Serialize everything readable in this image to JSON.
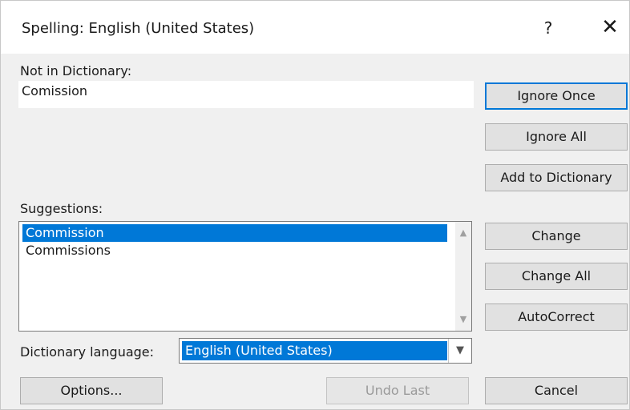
{
  "window": {
    "title": "Spelling: English (United States)",
    "help": "?",
    "close": "✕"
  },
  "not_in_dictionary": {
    "label": "Not in Dictionary:",
    "value": "Comission"
  },
  "buttons": {
    "ignore_once": "Ignore Once",
    "ignore_all": "Ignore All",
    "add_to_dictionary": "Add to Dictionary",
    "change": "Change",
    "change_all": "Change All",
    "autocorrect": "AutoCorrect",
    "options": "Options...",
    "undo_last": "Undo Last",
    "cancel": "Cancel"
  },
  "suggestions": {
    "label": "Suggestions:",
    "items": [
      "Commission",
      "Commissions"
    ],
    "selected": "Commission"
  },
  "dictionary_language": {
    "label": "Dictionary language:",
    "value": "English (United States)"
  },
  "colors": {
    "accent": "#0078d7",
    "dialog_bg": "#f0f0f0",
    "button_bg": "#e1e1e1"
  },
  "icons": {
    "scroll_up": "▲",
    "scroll_down": "▼",
    "dropdown": "▼"
  }
}
